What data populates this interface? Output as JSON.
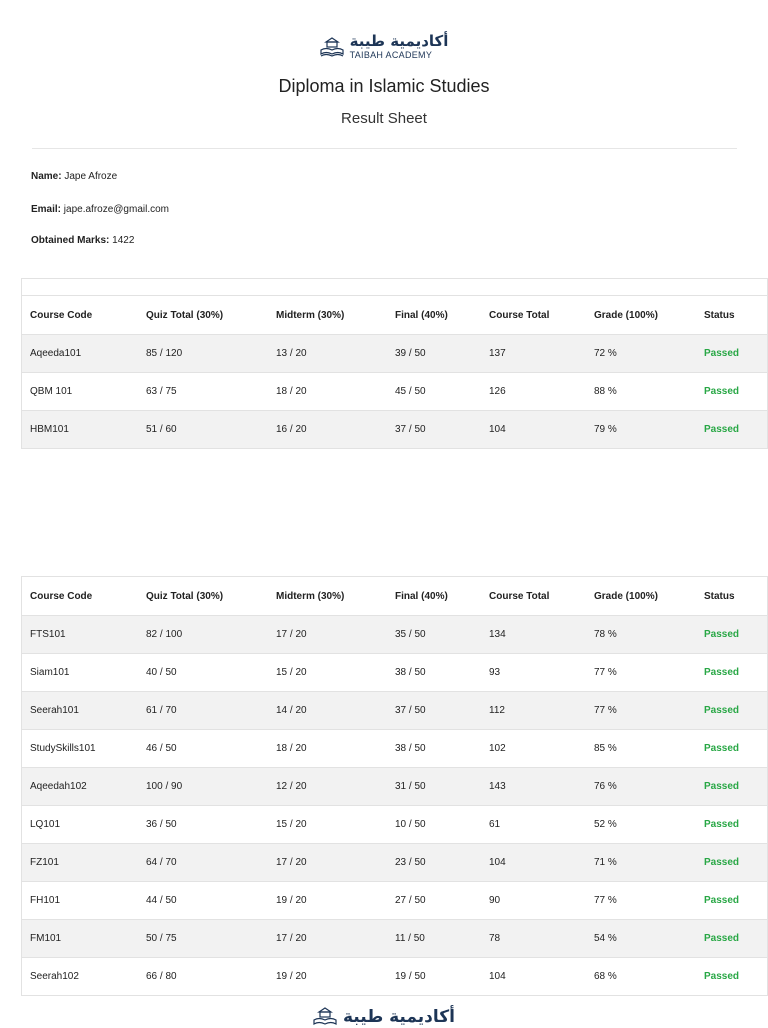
{
  "logo": {
    "arabic": "أكاديمية طيبة",
    "english": "TAIBAH ACADEMY"
  },
  "header": {
    "title": "Diploma in Islamic Studies",
    "subtitle": "Result Sheet"
  },
  "student": {
    "name_label": "Name:",
    "name": "Jape Afroze",
    "email_label": "Email:",
    "email": "jape.afroze@gmail.com",
    "marks_label": "Obtained Marks:",
    "marks": "1422"
  },
  "columns": [
    "Course Code",
    "Quiz Total (30%)",
    "Midterm (30%)",
    "Final (40%)",
    "Course Total",
    "Grade (100%)",
    "Status"
  ],
  "status_color": "#28a745",
  "table1": [
    [
      "Aqeeda101",
      "85 / 120",
      "13 / 20",
      "39 / 50",
      "137",
      "72 %",
      "Passed"
    ],
    [
      "QBM 101",
      "63 / 75",
      "18 / 20",
      "45 / 50",
      "126",
      "88 %",
      "Passed"
    ],
    [
      "HBM101",
      "51 / 60",
      "16 / 20",
      "37 / 50",
      "104",
      "79 %",
      "Passed"
    ]
  ],
  "table2": [
    [
      "FTS101",
      "82 / 100",
      "17 / 20",
      "35 / 50",
      "134",
      "78 %",
      "Passed"
    ],
    [
      "Siam101",
      "40 / 50",
      "15 / 20",
      "38 / 50",
      "93",
      "77 %",
      "Passed"
    ],
    [
      "Seerah101",
      "61 / 70",
      "14 / 20",
      "37 / 50",
      "112",
      "77 %",
      "Passed"
    ],
    [
      "StudySkills101",
      "46 / 50",
      "18 / 20",
      "38 / 50",
      "102",
      "85 %",
      "Passed"
    ],
    [
      "Aqeedah102",
      "100 / 90",
      "12 / 20",
      "31 / 50",
      "143",
      "76 %",
      "Passed"
    ],
    [
      "LQ101",
      "36 / 50",
      "15 / 20",
      "10 / 50",
      "61",
      "52 %",
      "Passed"
    ],
    [
      "FZ101",
      "64 / 70",
      "17 / 20",
      "23 / 50",
      "104",
      "71 %",
      "Passed"
    ],
    [
      "FH101",
      "44 / 50",
      "19 / 20",
      "27 / 50",
      "90",
      "77 %",
      "Passed"
    ],
    [
      "FM101",
      "50 / 75",
      "17 / 20",
      "11 / 50",
      "78",
      "54 %",
      "Passed"
    ],
    [
      "Seerah102",
      "66 / 80",
      "19 / 20",
      "19 / 50",
      "104",
      "68 %",
      "Passed"
    ]
  ]
}
